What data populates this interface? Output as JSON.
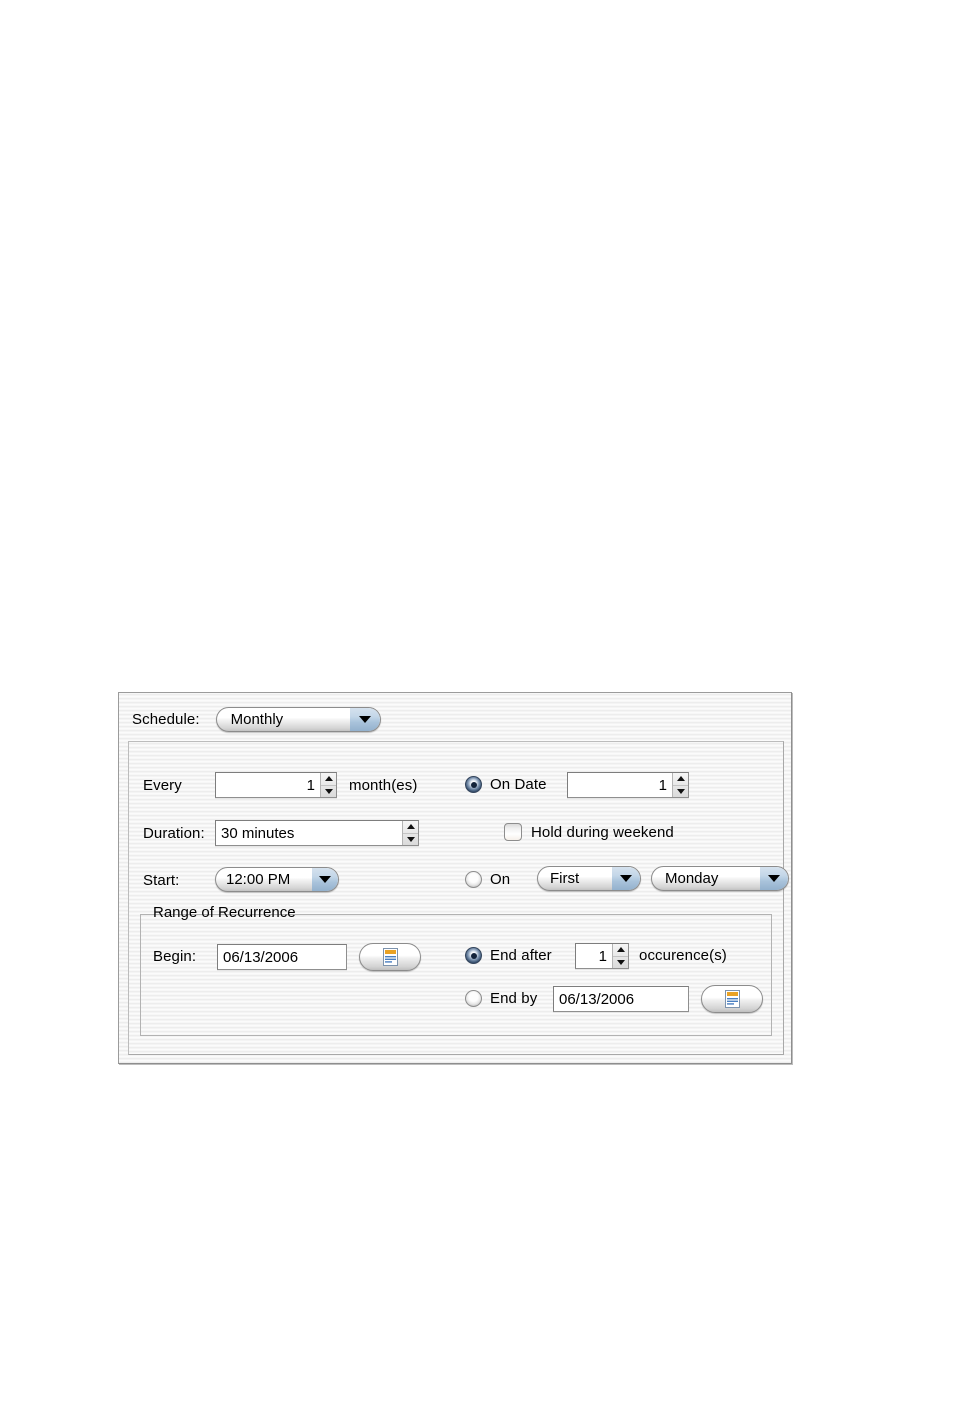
{
  "dialog": {
    "name": "recurrence-scheduler"
  },
  "schedule": {
    "label": "Schedule:",
    "value": "Monthly",
    "arrow_icon": "chevron-down-icon"
  },
  "every": {
    "label": "Every",
    "value": "1",
    "unit_label": "month(es)"
  },
  "on_date": {
    "label": "On Date",
    "selected": true,
    "value": "1"
  },
  "duration": {
    "label": "Duration:",
    "value": "30 minutes"
  },
  "hold_weekend": {
    "label": "Hold during weekend",
    "checked": false
  },
  "start": {
    "label": "Start:",
    "value": "12:00 PM",
    "arrow_icon": "chevron-down-icon"
  },
  "on_weekday": {
    "label": "On",
    "selected": false,
    "ordinal_value": "First",
    "day_value": "Monday"
  },
  "range": {
    "legend": "Range of Recurrence",
    "begin": {
      "label": "Begin:",
      "value": "06/13/2006",
      "button_icon": "calendar-note-icon"
    },
    "end_after": {
      "label": "End after",
      "selected": true,
      "value": "1",
      "unit_label": "occurence(s)"
    },
    "end_by": {
      "label": "End by",
      "selected": false,
      "value": "06/13/2006",
      "button_icon": "calendar-note-icon"
    }
  },
  "colors": {
    "panel_bg": "#f2f2f2",
    "border": "#9b9b9b",
    "combo_accent": "#a9c3db",
    "radio_selected": "#21364f",
    "icon_header": "#e9a225",
    "icon_lines": "#4a7fc1"
  }
}
